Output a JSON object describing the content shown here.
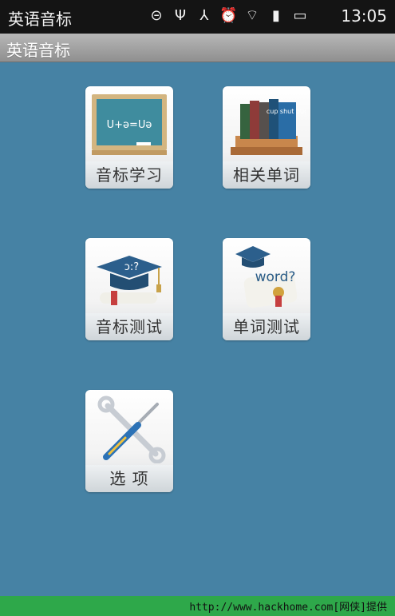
{
  "statusbar": {
    "app_name": "英语音标",
    "time": "13:05",
    "icons": [
      "app-icon",
      "usb-icon",
      "usb-debug-icon",
      "alarm-icon",
      "wifi-icon",
      "signal-icon",
      "battery-icon"
    ]
  },
  "titlebar": {
    "title": "英语音标"
  },
  "menu": {
    "items": [
      {
        "label": "音标学习",
        "icon": "chalkboard-icon",
        "board_text": "U+ə=Uə"
      },
      {
        "label": "相关单词",
        "icon": "books-icon",
        "book_text": "cup shut bug"
      },
      {
        "label": "音标测试",
        "icon": "graduation-cap-icon",
        "cap_text": "ɔ:?"
      },
      {
        "label": "单词测试",
        "icon": "diploma-icon",
        "word_text": "word?"
      },
      {
        "label": "选 项",
        "icon": "tools-icon"
      }
    ]
  },
  "footer": {
    "watermark": "http://www.hackhome.com[网侠]提供"
  },
  "colors": {
    "background": "#4682a4",
    "status_bar": "#141414",
    "footer": "#2ea84a"
  }
}
